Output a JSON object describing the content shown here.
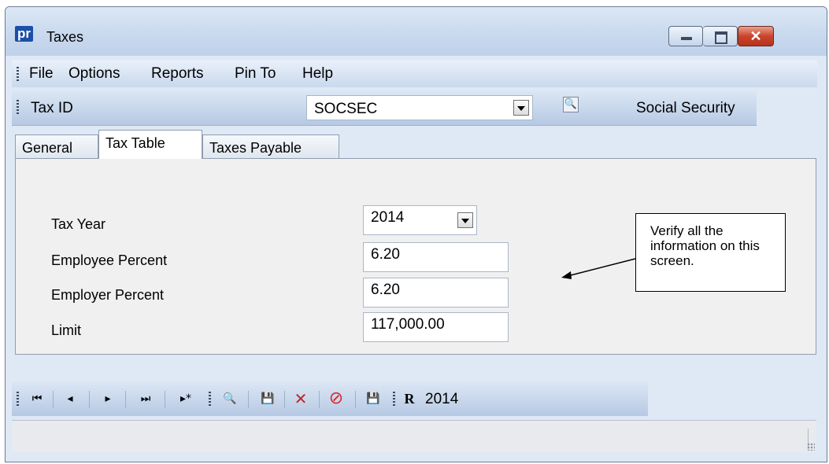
{
  "window": {
    "title": "Taxes",
    "app_icon_text": "pr"
  },
  "menu": {
    "items": [
      "File",
      "Options",
      "Reports",
      "Pin To",
      "Help"
    ]
  },
  "lookup": {
    "label": "Tax ID",
    "value": "SOCSEC",
    "description": "Social Security"
  },
  "tabs": [
    {
      "label": "General",
      "active": false
    },
    {
      "label": "Tax Table",
      "active": true
    },
    {
      "label": "Taxes Payable",
      "active": false
    }
  ],
  "form": {
    "tax_year_label": "Tax Year",
    "tax_year_value": "2014",
    "employee_percent_label": "Employee Percent",
    "employee_percent_value": "6.20",
    "employer_percent_label": "Employer Percent",
    "employer_percent_value": "6.20",
    "limit_label": "Limit",
    "limit_value": "117,000.00"
  },
  "callout": {
    "text": "Verify all the information on this screen."
  },
  "nav_toolbar": {
    "year": "2014",
    "icons": [
      "first-record-icon",
      "previous-record-icon",
      "next-record-icon",
      "last-record-icon",
      "new-record-icon",
      "search-icon",
      "save-icon",
      "delete-icon",
      "cancel-icon",
      "save-new-icon",
      "report-icon"
    ]
  },
  "colors": {
    "accent": "#1b4fa8",
    "close_button": "#c9452c",
    "toolbar": "#cad9ee",
    "panel": "#f0f0f0"
  }
}
